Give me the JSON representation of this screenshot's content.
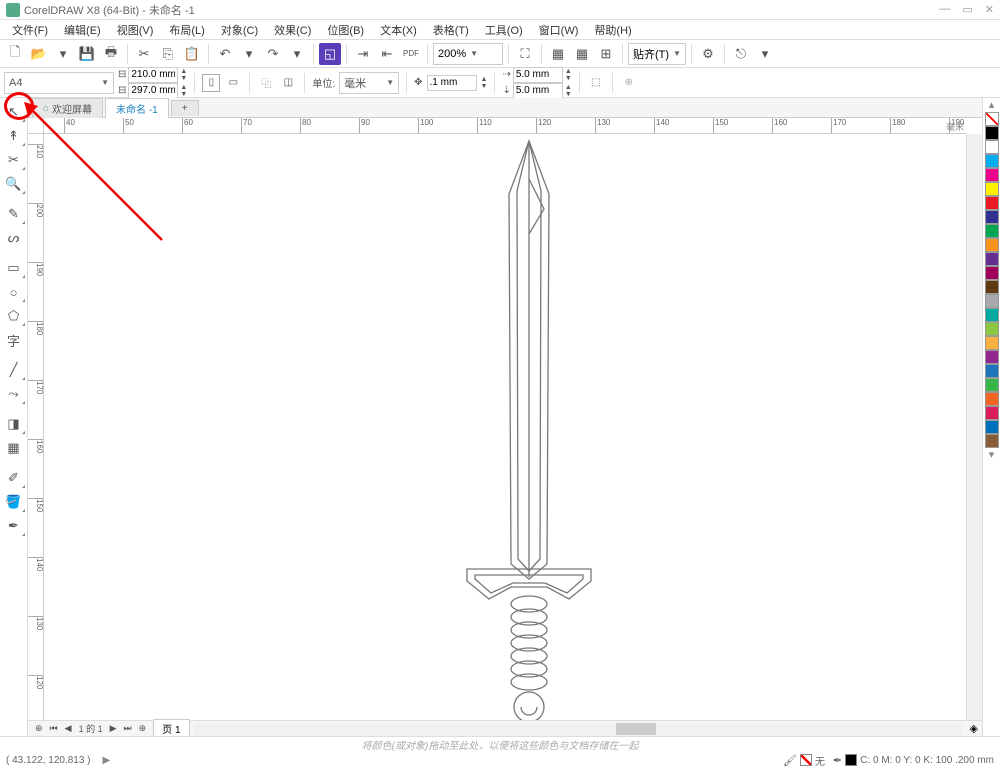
{
  "title": "CorelDRAW X8 (64-Bit) - 未命名 -1",
  "menubar": [
    "文件(F)",
    "编辑(E)",
    "视图(V)",
    "布局(L)",
    "对象(C)",
    "效果(C)",
    "位图(B)",
    "文本(X)",
    "表格(T)",
    "工具(O)",
    "窗口(W)",
    "帮助(H)"
  ],
  "toolbar": {
    "zoom": "200%",
    "align": "贴齐(T)"
  },
  "propbar": {
    "page_size": "A4",
    "width": "210.0 mm",
    "height": "297.0 mm",
    "unit_label": "单位:",
    "unit": "毫米",
    "nudge": ".1 mm",
    "dup_x": "5.0 mm",
    "dup_y": "5.0 mm"
  },
  "tabs": {
    "welcome": "欢迎屏幕",
    "doc": "未命名 -1"
  },
  "ruler_ticks_h": [
    "40",
    "50",
    "60",
    "70",
    "80",
    "90",
    "100",
    "110",
    "120",
    "130",
    "140",
    "150",
    "160",
    "170",
    "180",
    "190"
  ],
  "ruler_ticks_v": [
    "210",
    "200",
    "190",
    "180",
    "170",
    "160",
    "150",
    "140",
    "130",
    "120"
  ],
  "ruler_right": "毫米",
  "page_nav": {
    "label": "1 的 1",
    "tab": "页 1"
  },
  "status": {
    "hint": "将颜色(或对象)拖动至此处，以便将这些颜色与文档存储在一起",
    "cursor": "( 43.122, 120.813 )",
    "fill_none": "无",
    "outline_info": "C: 0 M: 0 Y: 0 K: 100  .200 mm"
  },
  "palette": [
    "#000",
    "#fff",
    "#00aeef",
    "#ec008c",
    "#fff200",
    "#ed1c24",
    "#2e3192",
    "#00a651",
    "#f7941d",
    "#662d91",
    "#9e005d",
    "#603913",
    "#a7a9ac",
    "#00a99d",
    "#8dc63f",
    "#fbb040",
    "#92278f",
    "#1c75bc",
    "#39b54a",
    "#f26522",
    "#da1c5c",
    "#0072bc",
    "#8a5d3b"
  ]
}
